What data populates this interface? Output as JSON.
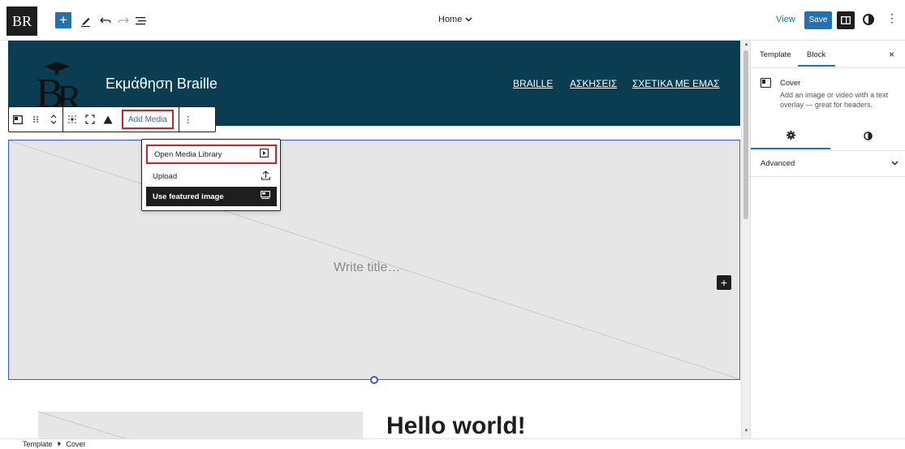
{
  "topbar": {
    "logo_text": "BR",
    "inserter": "+",
    "doc_title": "Home",
    "view_label": "View",
    "save_label": "Save"
  },
  "header": {
    "site_title": "Εκμάθηση Braille",
    "nav": [
      "BRAILLE",
      "ΑΣΚΗΣΕΙΣ",
      "ΣΧΕΤΙΚΑ ΜΕ ΕΜΑΣ"
    ]
  },
  "toolbar": {
    "add_media": "Add Media"
  },
  "media_menu": {
    "items": [
      "Open Media Library",
      "Upload",
      "Use featured image"
    ]
  },
  "cover": {
    "title_placeholder": "Write title…",
    "add_block": "+"
  },
  "content": {
    "heading": "Hello world!"
  },
  "sidebar": {
    "tabs": [
      "Template",
      "Block"
    ],
    "close": "×",
    "block_name": "Cover",
    "block_description": "Add an image or video with a text overlay — great for headers.",
    "advanced_label": "Advanced"
  },
  "breadcrumb": [
    "Template",
    "Cover"
  ],
  "colors": {
    "accent": "#2271b1",
    "header_bg": "#0a3d52",
    "highlight": "#d42020",
    "dark": "#1e1e1e"
  }
}
